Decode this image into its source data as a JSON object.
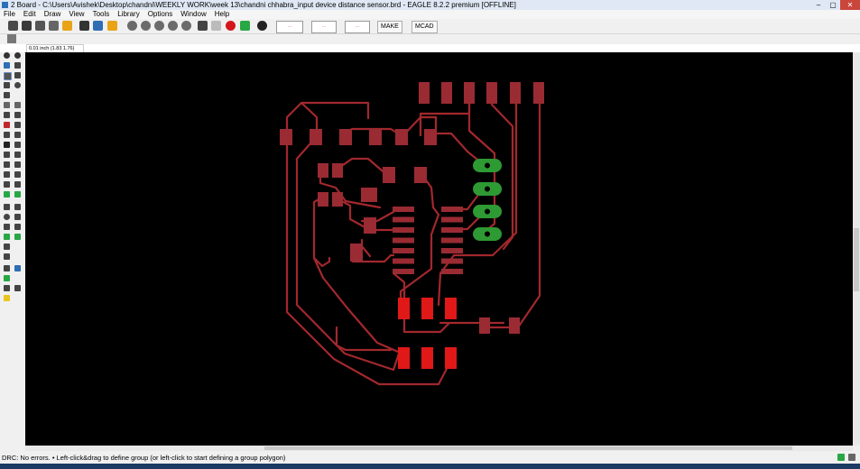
{
  "window": {
    "title": "2 Board - C:\\Users\\Avishek\\Desktop\\chandni\\WEEKLY WORK\\week 13\\chandni chhabra_input device distance sensor.brd - EAGLE 8.2.2 premium [OFFLINE]"
  },
  "menu": [
    "File",
    "Edit",
    "Draw",
    "View",
    "Tools",
    "Library",
    "Options",
    "Window",
    "Help"
  ],
  "toolbar": {
    "make_label": "MAKE",
    "mcad_label": "MCAD"
  },
  "coord": {
    "readout": "0.01 inch (1.83 1.76)"
  },
  "status": {
    "text": "DRC: No errors.  • Left-click&drag to define group (or left-click to start defining a group polygon)"
  },
  "colors": {
    "trace": "#a2282d",
    "pad": "#e01818",
    "smd": "#9a2b33",
    "ground_pad": "#2e9a33",
    "canvas": "#000000"
  }
}
